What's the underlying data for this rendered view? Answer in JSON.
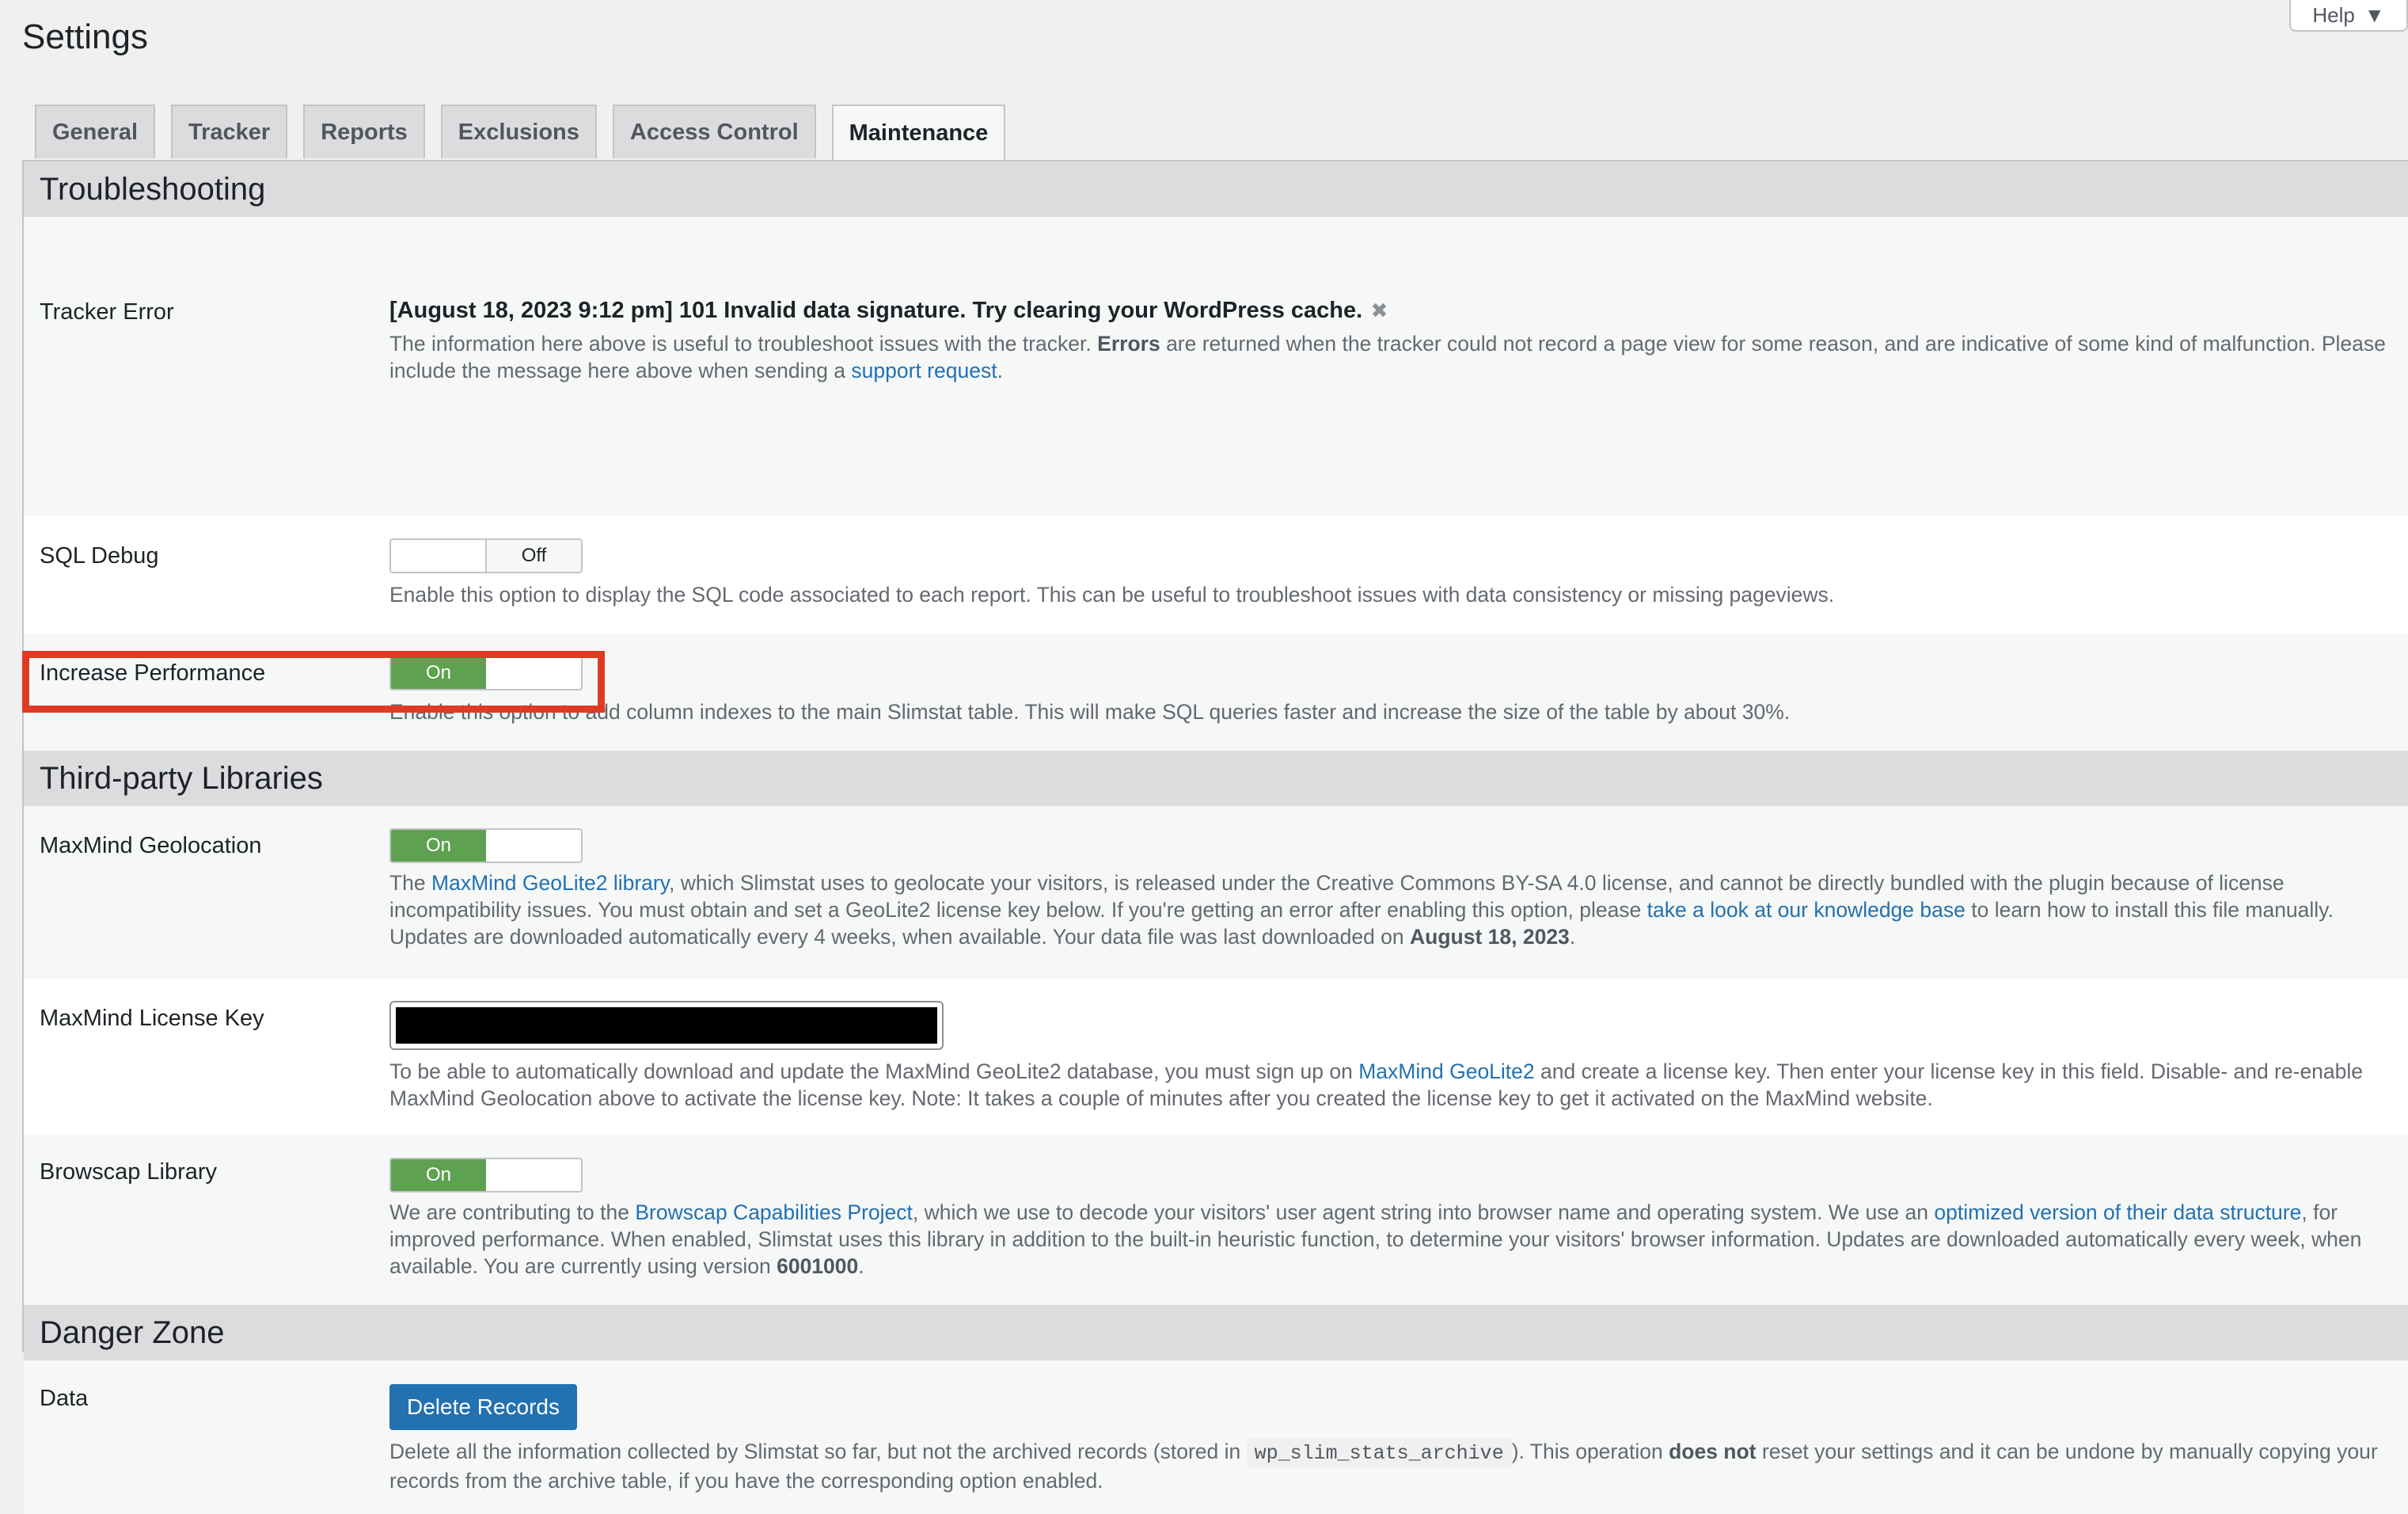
{
  "page": {
    "title": "Settings"
  },
  "help": {
    "label": "Help",
    "icon": "caret-down-icon"
  },
  "tabs": [
    {
      "label": "General"
    },
    {
      "label": "Tracker"
    },
    {
      "label": "Reports"
    },
    {
      "label": "Exclusions"
    },
    {
      "label": "Access Control"
    },
    {
      "label": "Maintenance",
      "active": true
    }
  ],
  "troubleshooting": {
    "heading": "Troubleshooting",
    "tracker_error": {
      "label": "Tracker Error",
      "message": "[August 18, 2023 9:12 pm] 101 Invalid data signature. Try clearing your WordPress cache.",
      "dismiss_icon": "close-icon",
      "desc_part1": "The information here above is useful to troubleshoot issues with the tracker.",
      "desc_bold": "Errors",
      "desc_part2": "are returned when the tracker could not record a page view for some reason, and are indicative of some kind of malfunction. Please include the message here above when sending a",
      "desc_link": "support request",
      "desc_end": "."
    },
    "sql_debug": {
      "label": "SQL Debug",
      "toggle_state": "Off",
      "desc": "Enable this option to display the SQL code associated to each report. This can be useful to troubleshoot issues with data consistency or missing pageviews."
    },
    "increase_performance": {
      "label": "Increase Performance",
      "toggle_state": "On",
      "desc": "Enable this option to add column indexes to the main Slimstat table. This will make SQL queries faster and increase the size of the table by about 30%."
    }
  },
  "third_party": {
    "heading": "Third-party Libraries",
    "maxmind": {
      "label": "MaxMind Geolocation",
      "toggle_state": "On",
      "desc_start": "The",
      "desc_link1": "MaxMind GeoLite2 library",
      "desc_mid1": ", which Slimstat uses to geolocate your visitors, is released under the Creative Commons BY-SA 4.0 license, and cannot be directly bundled with the plugin because of license incompatibility issues. You must obtain and set a GeoLite2 license key below. If you're getting an error after enabling this option, please",
      "desc_link2": "take a look at our knowledge base",
      "desc_mid2": "to learn how to install this file manually. Updates are downloaded automatically every 4 weeks, when available. Your data file was last downloaded on",
      "desc_date": "August 18, 2023",
      "desc_end": "."
    },
    "license_key": {
      "label": "MaxMind License Key",
      "desc_start": "To be able to automatically download and update the MaxMind GeoLite2 database, you must sign up on",
      "desc_link": "MaxMind GeoLite2",
      "desc_end": "and create a license key. Then enter your license key in this field. Disable- and re-enable MaxMind Geolocation above to activate the license key. Note: It takes a couple of minutes after you created the license key to get it activated on the MaxMind website."
    },
    "browscap": {
      "label": "Browscap Library",
      "toggle_state": "On",
      "desc_start": "We are contributing to the",
      "desc_link1": "Browscap Capabilities Project",
      "desc_mid1": ", which we use to decode your visitors' user agent string into browser name and operating system. We use an",
      "desc_link2": "optimized version of their data structure",
      "desc_mid2": ", for improved performance. When enabled, Slimstat uses this library in addition to the built-in heuristic function, to determine your visitors' browser information. Updates are downloaded automatically every week, when available. You are currently using version",
      "desc_version": "6001000",
      "desc_end": "."
    }
  },
  "danger_zone": {
    "heading": "Danger Zone",
    "data": {
      "label": "Data",
      "button": "Delete Records",
      "desc_start": "Delete all the information collected by Slimstat so far, but not the archived records (stored in",
      "desc_code": "wp_slim_stats_archive",
      "desc_mid": "). This operation",
      "desc_bold": "does not",
      "desc_end": "reset your settings and it can be undone by manually copying your records from the archive table, if you have the corresponding option enabled."
    }
  },
  "colors": {
    "accent": "#2271b1",
    "toggle_on": "#5ea150",
    "highlight": "#e03a24"
  }
}
